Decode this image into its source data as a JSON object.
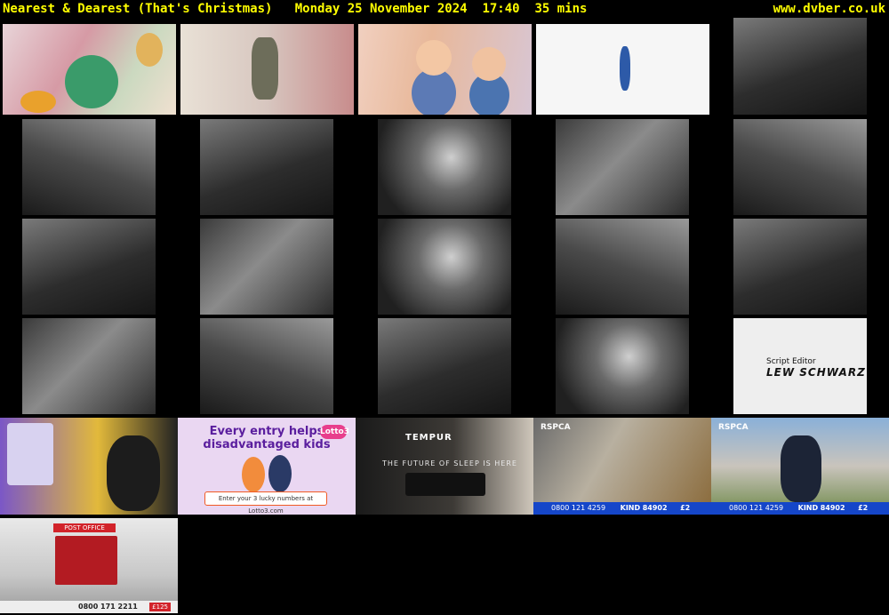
{
  "header": {
    "title": "Nearest & Dearest (That's Christmas)   Monday 25 November 2024  17:40  35 mins",
    "site": "www.dvber.co.uk"
  },
  "credit": {
    "role": "Script Editor",
    "name": "LEW SCHWARZ"
  },
  "ads": {
    "lotto_headline_1": "Every entry helps",
    "lotto_headline_2": "disadvantaged kids",
    "lotto_logo": "Lotto3",
    "lotto_cta": "Enter your 3 lucky numbers at Lotto3.com",
    "tempur_logo": "TEMPUR",
    "tempur_tagline": "THE FUTURE OF SLEEP IS HERE",
    "rspca_logo": "RSPCA",
    "rspca_phone": "0800 121 4259",
    "rspca_text": "KIND",
    "rspca_sms": "84902",
    "rspca_amount": "£2",
    "post_office_sign": "POST OFFICE",
    "post_office_phone": "0800 171 2211",
    "post_office_price": "£125"
  },
  "colors": {
    "header_text": "#ffff00",
    "background": "#000000",
    "rspca_blue": "#1546c9"
  }
}
